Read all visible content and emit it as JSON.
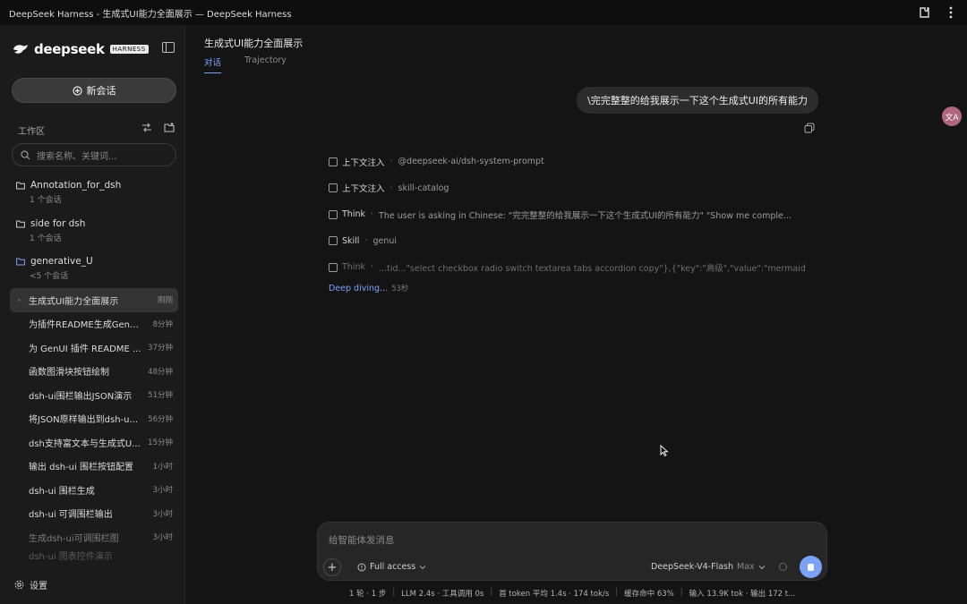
{
  "window": {
    "title": "DeepSeek Harness - 生成式UI能力全面展示 — DeepSeek Harness"
  },
  "brand": {
    "name": "deepseek",
    "badge": "HARNESS"
  },
  "sidebar": {
    "new_chat_label": "新会话",
    "workspace_label": "工作区",
    "search_placeholder": "搜索名称、关键词...",
    "folders": [
      {
        "name": "Annotation_for_dsh",
        "count": "1 个会话"
      },
      {
        "name": "side for dsh",
        "count": "1 个会话"
      },
      {
        "name": "generative_U",
        "count": "<5 个会话"
      }
    ],
    "chats": [
      {
        "title": "生成式UI能力全面展示",
        "time": "刚刚",
        "active": true
      },
      {
        "title": "为插件README生成GenUI...",
        "time": "8分钟"
      },
      {
        "title": "为 GenUI 插件 README ...",
        "time": "37分钟"
      },
      {
        "title": "函数图滑块按钮绘制",
        "time": "48分钟"
      },
      {
        "title": "dsh-ui围栏输出JSON演示",
        "time": "51分钟"
      },
      {
        "title": "将JSON原样输出到dsh-u...",
        "time": "56分钟"
      },
      {
        "title": "dsh支持富文本与生成式U...",
        "time": "15分钟"
      },
      {
        "title": "输出 dsh-ui 围栏按钮配置",
        "time": "1小时"
      },
      {
        "title": "dsh-ui 围栏生成",
        "time": "3小时"
      },
      {
        "title": "dsh-ui 可调围栏输出",
        "time": "3小时"
      },
      {
        "title": "生成dsh-ui可调围栏图",
        "time": "3小时"
      },
      {
        "title": "dsh-ui 图表控件演示",
        "time": ""
      }
    ],
    "settings_label": "设置"
  },
  "main": {
    "title": "生成式UI能力全面展示",
    "tabs": [
      {
        "label": "对话",
        "active": true
      },
      {
        "label": "Trajectory"
      }
    ],
    "user_message": "\\完完整整的给我展示一下这个生成式UI的所有能力",
    "avatar": "文A",
    "steps": [
      {
        "icon": "doc",
        "label": "上下文注入",
        "detail": "@deepseek-ai/dsh-system-prompt"
      },
      {
        "icon": "doc",
        "label": "上下文注入",
        "detail": "skill-catalog"
      },
      {
        "icon": "think",
        "label": "Think",
        "detail": "The user is asking in Chinese: \"完完整整的给我展示一下这个生成式UI的所有能力\"     \"Show me comple..."
      },
      {
        "icon": "skill",
        "label": "Skill",
        "detail": "genui"
      },
      {
        "icon": "think",
        "label": "Think",
        "detail": "...tid...\"select checkbox radio switch textarea tabs accordion copy\"},{\"key\":\"高级\",\"value\":\"mermaid",
        "dim": true
      }
    ],
    "deep_diving": {
      "label": "Deep diving...",
      "seconds": "53秒"
    }
  },
  "composer": {
    "placeholder": "给智能体发消息",
    "access_label": "Full access",
    "model_name": "DeepSeek-V4-Flash",
    "model_tier": "Max"
  },
  "stats": {
    "items": [
      "1 轮 · 1 步",
      "LLM 2.4s · 工具调用 0s",
      "首 token 平均 1.4s · 174 tok/s",
      "缓存命中 63%",
      "输入 13.9K tok · 输出 172 t..."
    ]
  },
  "colors": {
    "accent": "#7aa2f7",
    "avatar": "#b0657f"
  }
}
